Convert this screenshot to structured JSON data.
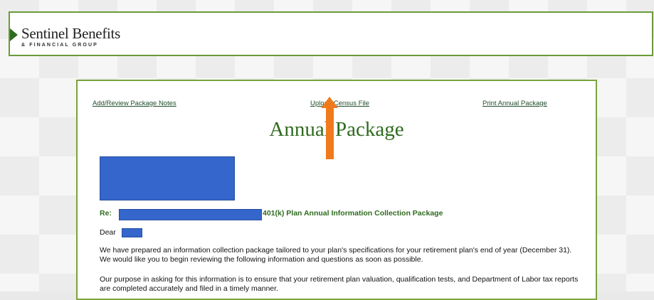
{
  "logo": {
    "name": "Sentinel Benefits",
    "tagline": "& FINANCIAL GROUP"
  },
  "links": {
    "notes": "Add/Review Package Notes",
    "census": "Upload Census File",
    "print": "Print Annual Package"
  },
  "page": {
    "title": "Annual Package"
  },
  "letter": {
    "re_label": "Re:",
    "re_text": "401(k) Plan Annual Information Collection Package",
    "salutation": "Dear",
    "paragraph1": "We have prepared an information collection package tailored to your plan's specifications for your retirement plan's end of year (December 31). We would like you to begin reviewing the following information and questions as soon as possible.",
    "paragraph2": "Our purpose in asking for this information is to ensure that your retirement plan valuation, qualification tests, and Department of Labor tax reports are completed accurately and filed in a timely manner."
  },
  "colors": {
    "brand_green": "#2f6b1f",
    "border_green": "#7aa33b",
    "annotation_arrow": "#f07a1c",
    "redaction": "#3466cc"
  }
}
